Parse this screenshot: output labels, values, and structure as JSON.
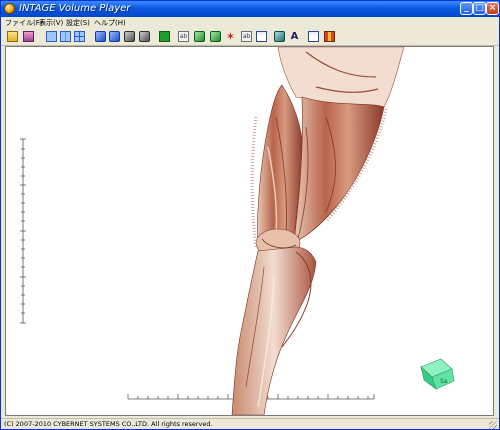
{
  "window": {
    "title": "INTAGE Volume Player",
    "buttons": {
      "minimize": "_",
      "maximize": "□",
      "close": "×"
    }
  },
  "menu": {
    "items": [
      {
        "label": "ファイル(F)"
      },
      {
        "label": "表示(V)"
      },
      {
        "label": "設定(S)"
      },
      {
        "label": "ヘルプ(H)"
      }
    ]
  },
  "toolbar": {
    "icons": [
      "open-folder-icon",
      "layers-icon",
      "single-view-icon",
      "dual-view-icon",
      "quad-view-icon",
      "blue-cube-icon",
      "blue-cube-2-icon",
      "gray-cube-icon",
      "gray-cube-2-icon",
      "green-square-icon",
      "preset-icon",
      "green-cube-icon",
      "wire-cube-icon",
      "axes-icon",
      "label-icon",
      "panel-icon",
      "teal-cube-icon",
      "text-a-icon",
      "window-icon",
      "color-grid-icon"
    ],
    "small_labels": {
      "preset": "ab",
      "label": "ab"
    },
    "axes_glyph": "✶",
    "letter": "A"
  },
  "viewport": {
    "background": "#ffffff",
    "tissue_colors": {
      "muscle": "#b8644a",
      "highlight": "#f2ddd0",
      "shadow": "#7a2e22"
    },
    "orientation_cube_color": "#5fe3a2",
    "orientation_cube_label": "Sa"
  },
  "status": {
    "text": "(C) 2007-2010 CYBERNET SYSTEMS CO.,LTD. All rights reserved."
  }
}
